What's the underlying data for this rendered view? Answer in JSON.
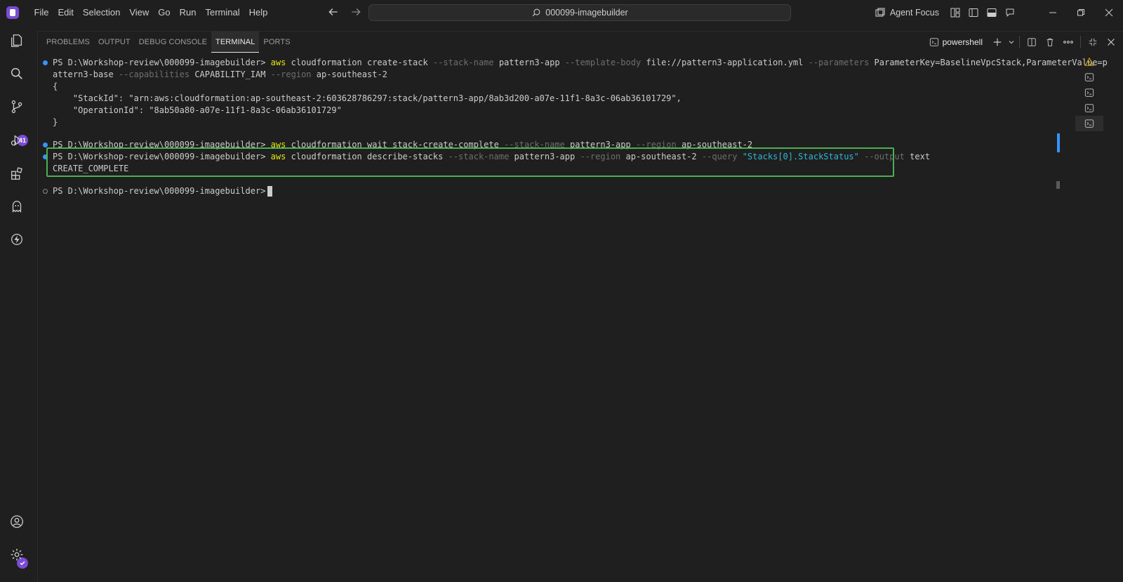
{
  "menu": [
    "File",
    "Edit",
    "Selection",
    "View",
    "Go",
    "Run",
    "Terminal",
    "Help"
  ],
  "search": {
    "text": "000099-imagebuilder"
  },
  "title_right": {
    "agent_focus": "Agent Focus"
  },
  "activity": {
    "source_control_badge": "41"
  },
  "panel": {
    "tabs": [
      "PROBLEMS",
      "OUTPUT",
      "DEBUG CONSOLE",
      "TERMINAL",
      "PORTS"
    ],
    "shell": "powershell"
  },
  "terminal": {
    "prompt": "PS D:\\Workshop-review\\000099-imagebuilder>",
    "cmd1": {
      "aws": "aws",
      "sub": "cloudformation",
      "action": "create-stack",
      "opt_stack_name": "--stack-name",
      "stack_name": "pattern3-app",
      "opt_template": "--template-body",
      "template": "file://pattern3-application.yml",
      "opt_parameters": "--parameters",
      "parameters_a": "ParameterKey=BaselineVpcStack,ParameterValue=p",
      "parameters_b": "attern3-base",
      "opt_capabilities": "--capabilities",
      "capabilities": "CAPABILITY_IAM",
      "opt_region": "--region",
      "region": "ap-southeast-2"
    },
    "output1": [
      "{",
      "    \"StackId\": \"arn:aws:cloudformation:ap-southeast-2:603628786297:stack/pattern3-app/8ab3d200-a07e-11f1-8a3c-06ab36101729\",",
      "    \"OperationId\": \"8ab50a80-a07e-11f1-8a3c-06ab36101729\"",
      "}"
    ],
    "cmd2": {
      "aws": "aws",
      "sub": "cloudformation",
      "action": "wait stack-create-complete",
      "opt_stack_name": "--stack-name",
      "stack_name": "pattern3-app",
      "opt_region": "--region",
      "region": "ap-southeast-2"
    },
    "cmd3": {
      "aws": "aws",
      "sub": "cloudformation",
      "action": "describe-stacks",
      "opt_stack_name": "--stack-name",
      "stack_name": "pattern3-app",
      "opt_region": "--region",
      "region": "ap-southeast-2",
      "opt_query": "--query",
      "query": "\"Stacks[0].StackStatus\"",
      "opt_output": "--output",
      "output": "text"
    },
    "result3": "CREATE_COMPLETE"
  },
  "colors": {
    "accent": "#7b4bd6",
    "highlight_box": "#4caf50",
    "command": "#e5e510",
    "option": "#6e6e6e",
    "string": "#2fb5d0",
    "success_dot": "#3794ff"
  }
}
